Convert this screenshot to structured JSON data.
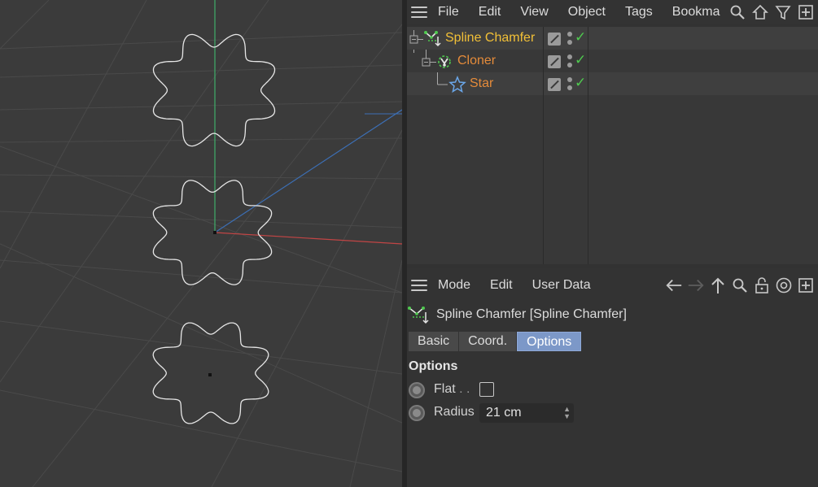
{
  "object_manager": {
    "menu": [
      "File",
      "Edit",
      "View",
      "Object",
      "Tags",
      "Bookma"
    ],
    "toolbar_icons": [
      "search-icon",
      "home-icon",
      "filter-icon",
      "new-panel-icon"
    ],
    "objects": [
      {
        "name": "Spline Chamfer",
        "color": "#f2c037",
        "icon": "spline-chamfer-icon",
        "selected": true
      },
      {
        "name": "Cloner",
        "color": "#e48b3a",
        "icon": "cloner-icon"
      },
      {
        "name": "Star",
        "color": "#e48b3a",
        "icon": "star-icon"
      }
    ],
    "check_color": "#4fc94f"
  },
  "attributes": {
    "menu": [
      "Mode",
      "Edit",
      "User Data"
    ],
    "toolbar_icons": [
      "back-arrow-icon",
      "forward-arrow-icon",
      "up-arrow-icon",
      "search-icon",
      "lock-icon",
      "target-icon",
      "new-panel-icon"
    ],
    "title": "Spline Chamfer [Spline Chamfer]",
    "tabs": [
      "Basic",
      "Coord.",
      "Options"
    ],
    "active_tab": "Options",
    "active_tab_color": "#7c98c8",
    "section_title": "Options",
    "props": {
      "flat_label": "Flat",
      "flat_dots": ". .",
      "flat_checked": false,
      "radius_label": "Radius",
      "radius_value": "21 cm"
    }
  },
  "viewport": {
    "shapes": [
      "star-chamfered-1",
      "star-chamfered-2",
      "star-chamfered-3"
    ],
    "axis_colors": {
      "x": "#c24545",
      "y": "#3fae6a",
      "z": "#3c6fb5"
    }
  }
}
